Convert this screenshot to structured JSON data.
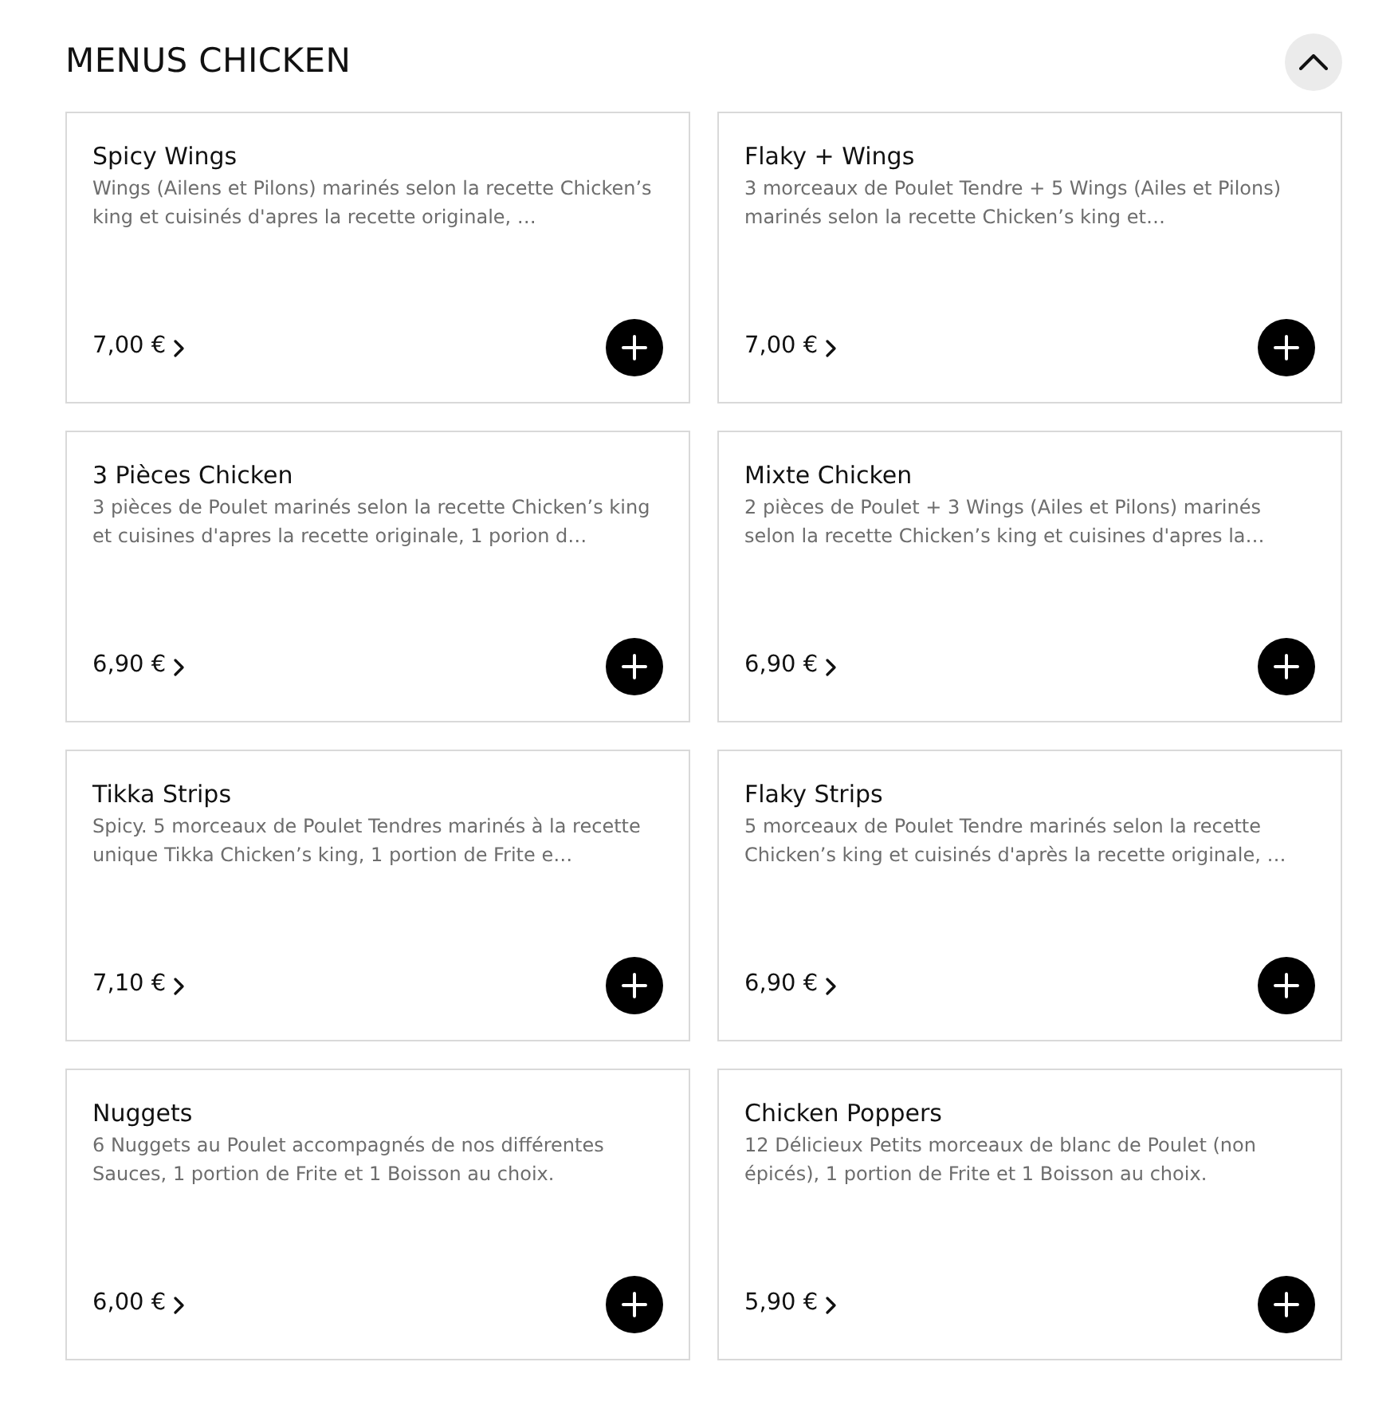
{
  "section": {
    "title": "MENUS CHICKEN",
    "expanded": true
  },
  "items": [
    {
      "name": "Spicy Wings",
      "description": "Wings (Ailens et Pilons) marinés selon la recette Chicken’s king et cuisinés d'apres la recette originale, …",
      "price": "7,00 €"
    },
    {
      "name": "Flaky + Wings",
      "description": "3 morceaux de Poulet Tendre + 5 Wings (Ailes et Pilons) marinés selon la recette Chicken’s king et…",
      "price": "7,00 €"
    },
    {
      "name": "3 Pièces Chicken",
      "description": "3 pièces de Poulet marinés selon la recette Chicken’s king et cuisines d'apres la recette originale, 1 porion d…",
      "price": "6,90 €"
    },
    {
      "name": "Mixte Chicken",
      "description": "2 pièces de Poulet + 3 Wings (Ailes et Pilons) marinés selon la recette Chicken’s king et cuisines d'apres la…",
      "price": "6,90 €"
    },
    {
      "name": "Tikka Strips",
      "description": "Spicy. 5 morceaux de Poulet Tendres marinés à la recette unique Tikka Chicken’s king, 1 portion de Frite e…",
      "price": "7,10 €"
    },
    {
      "name": "Flaky Strips",
      "description": "5 morceaux de Poulet Tendre marinés selon la recette Chicken’s king et cuisinés d'après la recette originale, …",
      "price": "6,90 €"
    },
    {
      "name": "Nuggets",
      "description": "6 Nuggets au Poulet accompagnés de nos différentes Sauces, 1 portion de Frite et 1 Boisson au choix.",
      "price": "6,00 €"
    },
    {
      "name": "Chicken Poppers",
      "description": "12 Délicieux Petits morceaux de blanc de Poulet (non épicés), 1 portion de Frite et 1 Boisson au choix.",
      "price": "5,90 €"
    }
  ]
}
